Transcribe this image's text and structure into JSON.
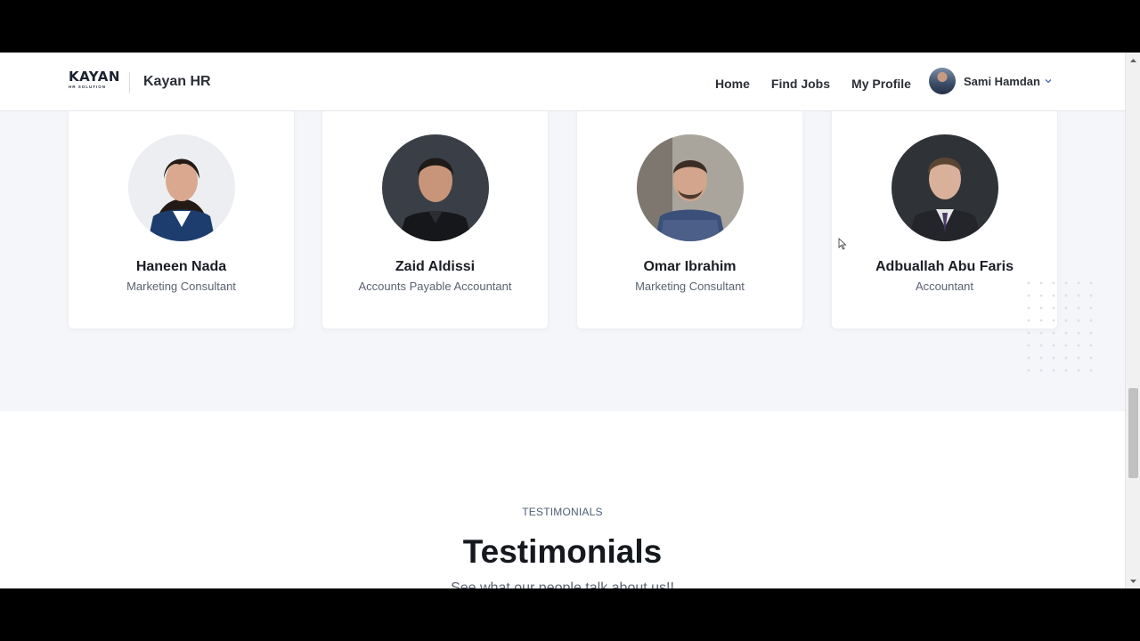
{
  "header": {
    "logo_text": "KAYAN",
    "logo_subtext": "HR SOLUTION",
    "brand_name": "Kayan HR",
    "nav": [
      "Home",
      "Find Jobs",
      "My Profile"
    ],
    "user_name": "Sami Hamdan"
  },
  "team": [
    {
      "name": "Haneen Nada",
      "role": "Marketing Consultant"
    },
    {
      "name": "Zaid Aldissi",
      "role": "Accounts Payable Accountant"
    },
    {
      "name": "Omar Ibrahim",
      "role": "Marketing Consultant"
    },
    {
      "name": "Adbuallah Abu Faris",
      "role": "Accountant"
    }
  ],
  "testimonials": {
    "tag": "TESTIMONIALS",
    "title": "Testimonials",
    "subtitle": "See what our people talk about us!!"
  },
  "colors": {
    "accent": "#4d5f7a",
    "text_dark": "#1b1e24",
    "page_bg": "#f4f6f9"
  }
}
